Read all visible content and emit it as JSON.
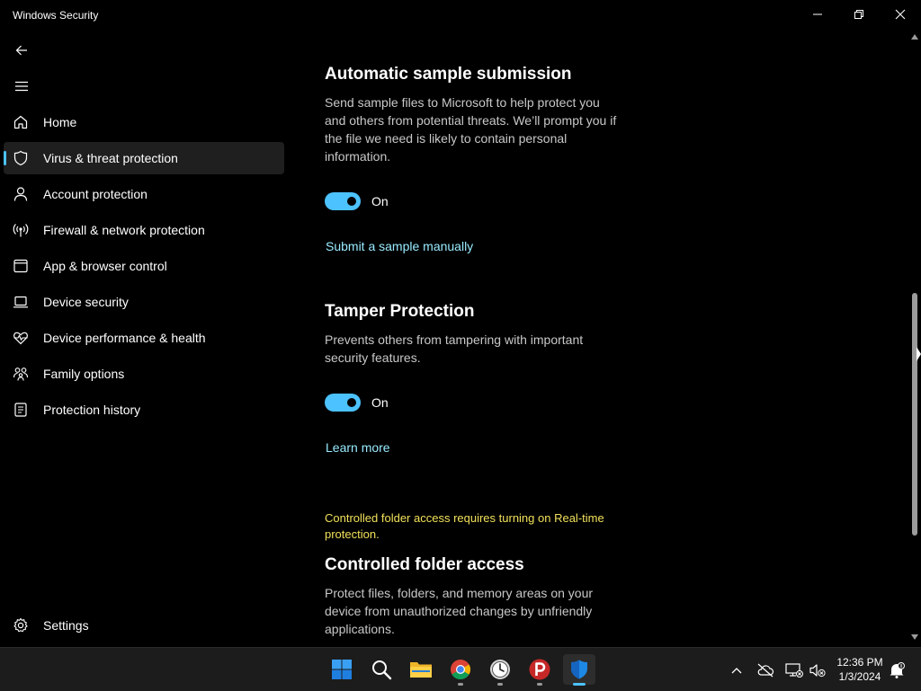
{
  "window": {
    "title": "Windows Security"
  },
  "sidebar": {
    "items": [
      {
        "label": "Home",
        "icon": "home-icon",
        "active": false
      },
      {
        "label": "Virus & threat protection",
        "icon": "shield-icon",
        "active": true
      },
      {
        "label": "Account protection",
        "icon": "person-icon",
        "active": false
      },
      {
        "label": "Firewall & network protection",
        "icon": "wireless-icon",
        "active": false
      },
      {
        "label": "App & browser control",
        "icon": "app-window-icon",
        "active": false
      },
      {
        "label": "Device security",
        "icon": "laptop-icon",
        "active": false
      },
      {
        "label": "Device performance & health",
        "icon": "heart-pulse-icon",
        "active": false
      },
      {
        "label": "Family options",
        "icon": "family-icon",
        "active": false
      },
      {
        "label": "Protection history",
        "icon": "history-icon",
        "active": false
      }
    ],
    "settings_label": "Settings"
  },
  "main": {
    "sample_submission": {
      "title": "Automatic sample submission",
      "description": "Send sample files to Microsoft to help protect you and others from potential threats. We’ll prompt you if the file we need is likely to contain personal information.",
      "toggle_state": "On",
      "link": "Submit a sample manually"
    },
    "tamper": {
      "title": "Tamper Protection",
      "description": "Prevents others from tampering with important security features.",
      "toggle_state": "On",
      "link": "Learn more"
    },
    "controlled_folder": {
      "warning": "Controlled folder access requires turning on Real-time protection.",
      "title": "Controlled folder access",
      "description": "Protect files, folders, and memory areas on your device from unauthorized changes by unfriendly applications."
    }
  },
  "taskbar": {
    "apps": [
      "windows-start-icon",
      "search-icon",
      "file-explorer-icon",
      "chrome-icon",
      "clock-app-icon",
      "psiphon-icon",
      "windows-security-icon"
    ],
    "time": "12:36 PM",
    "date": "1/3/2024"
  },
  "colors": {
    "accent": "#4cc2ff",
    "link": "#99ebff",
    "warning": "#f1e05a",
    "background": "#000000"
  }
}
